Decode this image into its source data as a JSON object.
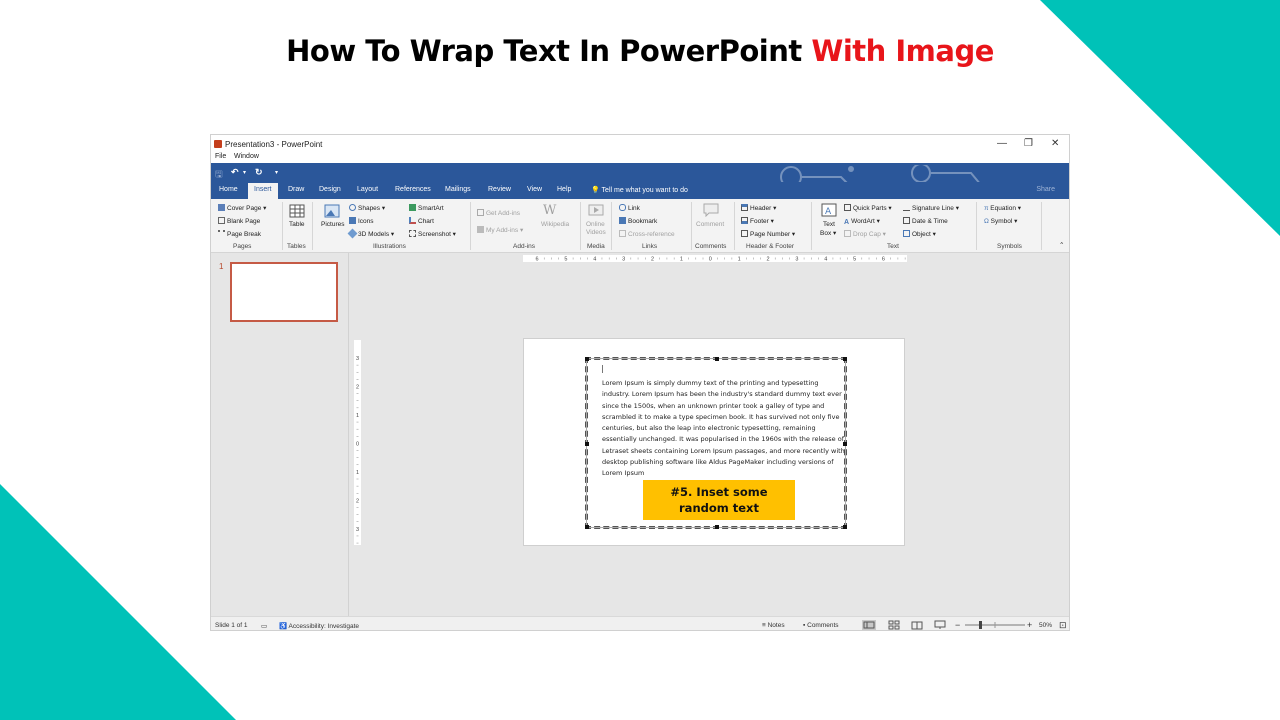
{
  "heading": {
    "part1": "How To Wrap Text In PowerPoint ",
    "part2": "With Image"
  },
  "colors": {
    "teal": "#00c2b8",
    "ribbon_blue": "#2b579a",
    "title_red": "#e8151a",
    "callout": "#ffc000",
    "thumb_border": "#c55a45"
  },
  "window": {
    "title": "Presentation3 - PowerPoint",
    "menu": [
      "File",
      "Window"
    ],
    "controls": {
      "minimize": "—",
      "restore": "❐",
      "close": "✕"
    }
  },
  "qat": {
    "save": "🖫",
    "undo": "↶",
    "undo_more": "▾",
    "redo": "↻",
    "customize": "▾"
  },
  "tabs": [
    "Home",
    "Insert",
    "Draw",
    "Design",
    "Layout",
    "References",
    "Mailings",
    "Review",
    "View",
    "Help"
  ],
  "active_tab": "Insert",
  "tell_me": "Tell me what you want to do",
  "share": "Share",
  "ribbon": {
    "pages": {
      "items": [
        "Cover Page ▾",
        "Blank Page",
        "Page Break"
      ],
      "label": "Pages"
    },
    "tables": {
      "table": "Table",
      "label": "Tables"
    },
    "illustrations": {
      "pictures": "Pictures",
      "shapes": "Shapes ▾",
      "icons": "Icons",
      "models": "3D Models ▾",
      "smartart": "SmartArt",
      "chart": "Chart",
      "screenshot": "Screenshot ▾",
      "label": "Illustrations"
    },
    "addins": {
      "get": "Get Add-ins",
      "my": "My Add-ins ▾",
      "wikipedia": "Wikipedia",
      "label": "Add-ins"
    },
    "media": {
      "online_videos_1": "Online",
      "online_videos_2": "Videos",
      "label": "Media"
    },
    "links": {
      "link": "Link",
      "bookmark": "Bookmark",
      "crossref": "Cross-reference",
      "label": "Links"
    },
    "comments": {
      "comment": "Comment",
      "label": "Comments"
    },
    "header_footer": {
      "header": "Header ▾",
      "footer": "Footer ▾",
      "page_number": "Page Number ▾",
      "label": "Header & Footer"
    },
    "text": {
      "textbox_1": "Text",
      "textbox_2": "Box ▾",
      "quick_parts": "Quick Parts ▾",
      "wordart": "WordArt ▾",
      "drop_cap": "Drop Cap ▾",
      "signature": "Signature Line ▾",
      "datetime": "Date & Time",
      "object": "Object ▾",
      "label": "Text"
    },
    "symbols": {
      "equation": "Equation ▾",
      "symbol": "Symbol ▾",
      "label": "Symbols"
    },
    "collapse": "⌃"
  },
  "thumbnail": {
    "number": "1"
  },
  "ruler": {
    "h_labels": [
      "6",
      "5",
      "4",
      "3",
      "2",
      "1",
      "0",
      "1",
      "2",
      "3",
      "4",
      "5",
      "6"
    ],
    "v_labels": [
      "3",
      "2",
      "1",
      "0",
      "1",
      "2",
      "3"
    ]
  },
  "slide": {
    "body": "Lorem Ipsum is simply dummy text of the printing and typesetting industry. Lorem Ipsum has been the industry's standard dummy text ever since the 1500s, when an unknown printer took a galley of type and scrambled it to make a type specimen book. It has survived not only five centuries, but also the leap into electronic typesetting, remaining essentially unchanged. It was popularised in the 1960s with the release of Letraset sheets containing Lorem Ipsum passages, and more recently with desktop publishing software like Aldus PageMaker including versions of Lorem Ipsum",
    "callout_line1": "#5. Inset some",
    "callout_line2": "random text"
  },
  "status": {
    "slide": "Slide 1 of 1",
    "accessibility": "Accessibility: Investigate",
    "notes": "Notes",
    "comments": "Comments",
    "zoom_minus": "−",
    "zoom_plus": "+",
    "zoom": "50%",
    "fit_icon": "⊡"
  }
}
